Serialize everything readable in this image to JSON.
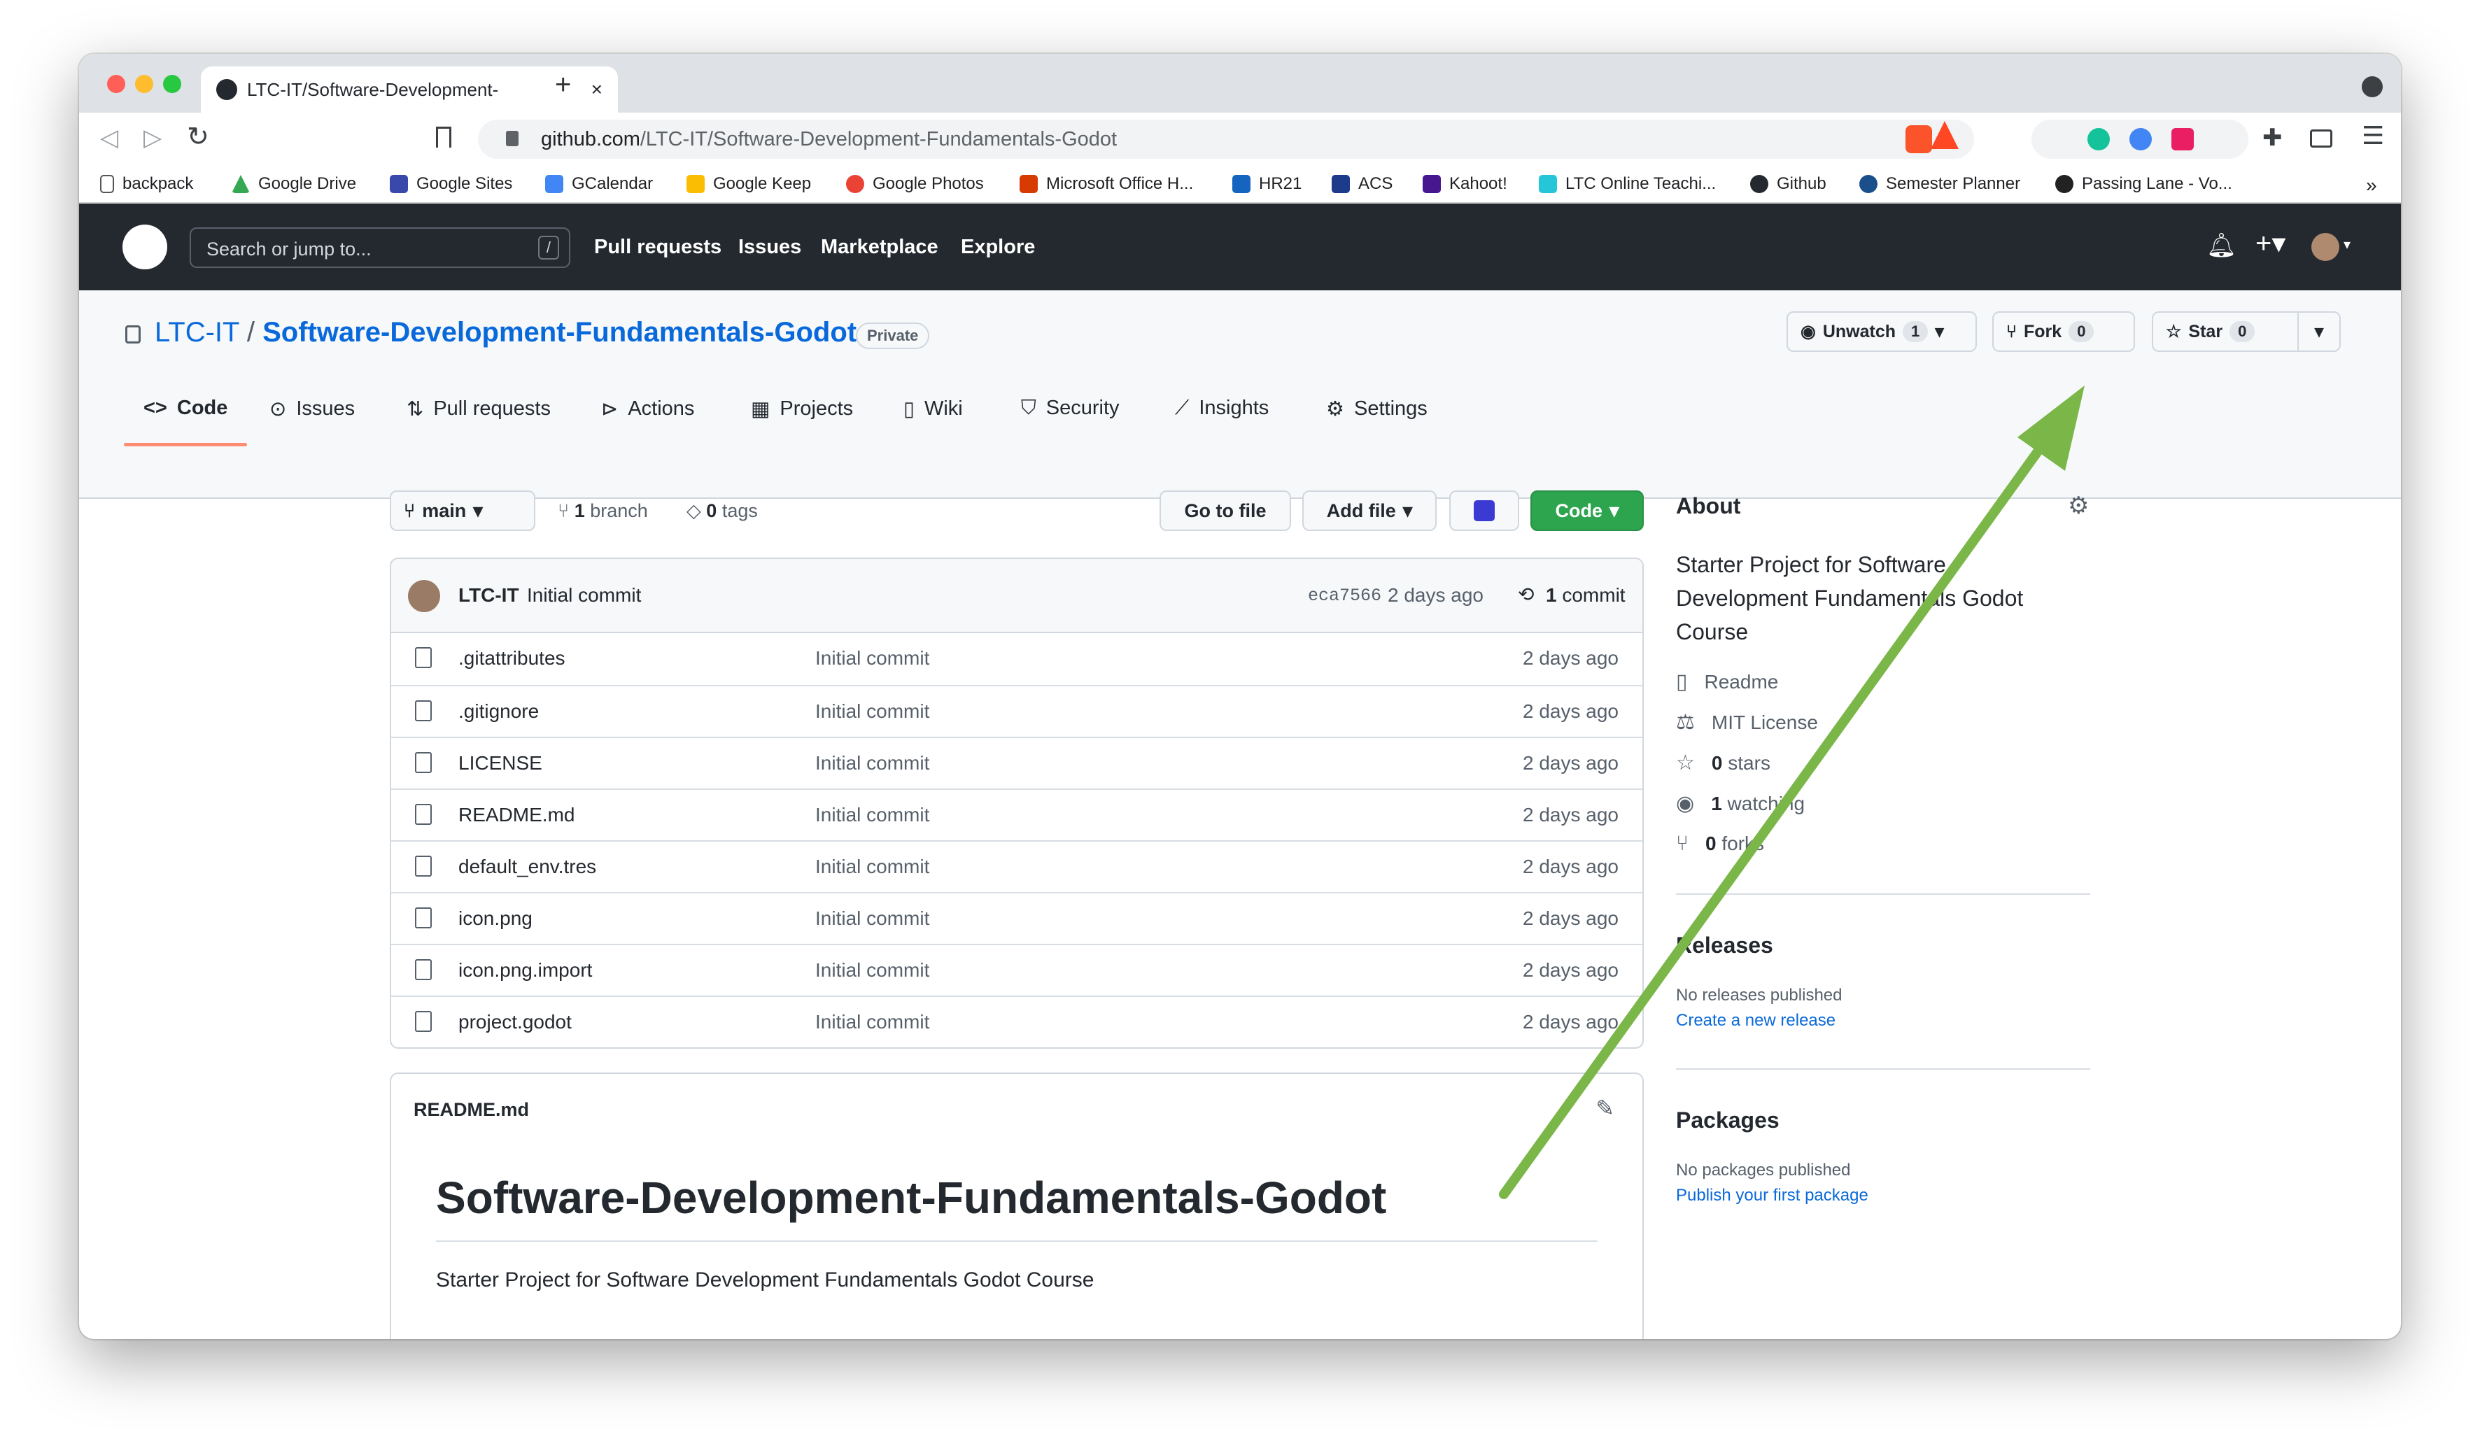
{
  "browser": {
    "tab_title": "LTC-IT/Software-Development-",
    "url_host": "github.com",
    "url_path": "/LTC-IT/Software-Development-Fundamentals-Godot",
    "bookmarks": [
      {
        "label": "backpack",
        "icon": "page-icon",
        "color": "#ffffff"
      },
      {
        "label": "Google Drive",
        "icon": "google-drive-icon",
        "color": "#34a853"
      },
      {
        "label": "Google Sites",
        "icon": "google-sites-icon",
        "color": "#3949ab"
      },
      {
        "label": "GCalendar",
        "icon": "calendar-icon",
        "color": "#4285f4"
      },
      {
        "label": "Google Keep",
        "icon": "keep-icon",
        "color": "#fbbc04"
      },
      {
        "label": "Google Photos",
        "icon": "photos-icon",
        "color": "#ea4335"
      },
      {
        "label": "Microsoft Office H...",
        "icon": "office-icon",
        "color": "#d83b01"
      },
      {
        "label": "HR21",
        "icon": "hr21-icon",
        "color": "#1565c0"
      },
      {
        "label": "ACS",
        "icon": "acs-icon",
        "color": "#1e3a8a"
      },
      {
        "label": "Kahoot!",
        "icon": "kahoot-icon",
        "color": "#46178f"
      },
      {
        "label": "LTC Online Teachi...",
        "icon": "ltc-icon",
        "color": "#26c6da"
      },
      {
        "label": "Github",
        "icon": "github-icon",
        "color": "#24292f"
      },
      {
        "label": "Semester Planner",
        "icon": "planner-icon",
        "color": "#1a4f8b"
      },
      {
        "label": "Passing Lane - Vo...",
        "icon": "passing-lane-icon",
        "color": "#222222"
      }
    ],
    "more_bookmarks": "»"
  },
  "header": {
    "search_placeholder": "Search or jump to...",
    "search_shortcut": "/",
    "nav": [
      "Pull requests",
      "Issues",
      "Marketplace",
      "Explore"
    ]
  },
  "repo": {
    "owner": "LTC-IT",
    "separator": "/",
    "name": "Software-Development-Fundamentals-Godot",
    "visibility": "Private",
    "unwatch_label": "Unwatch",
    "watch_count": "1",
    "fork_label": "Fork",
    "fork_count": "0",
    "star_label": "Star",
    "star_count": "0",
    "tabs": [
      "Code",
      "Issues",
      "Pull requests",
      "Actions",
      "Projects",
      "Wiki",
      "Security",
      "Insights",
      "Settings"
    ]
  },
  "filenav": {
    "branch": "main",
    "branches_count": "1",
    "branches_label": "branch",
    "tags_count": "0",
    "tags_label": "tags",
    "go_to_file": "Go to file",
    "add_file": "Add file",
    "code_label": "Code"
  },
  "commit": {
    "author": "LTC-IT",
    "message": "Initial commit",
    "sha": "eca7566",
    "time": "2 days ago",
    "count": "1",
    "count_label": "commit"
  },
  "files": [
    {
      "name": ".gitattributes",
      "message": "Initial commit",
      "date": "2 days ago"
    },
    {
      "name": ".gitignore",
      "message": "Initial commit",
      "date": "2 days ago"
    },
    {
      "name": "LICENSE",
      "message": "Initial commit",
      "date": "2 days ago"
    },
    {
      "name": "README.md",
      "message": "Initial commit",
      "date": "2 days ago"
    },
    {
      "name": "default_env.tres",
      "message": "Initial commit",
      "date": "2 days ago"
    },
    {
      "name": "icon.png",
      "message": "Initial commit",
      "date": "2 days ago"
    },
    {
      "name": "icon.png.import",
      "message": "Initial commit",
      "date": "2 days ago"
    },
    {
      "name": "project.godot",
      "message": "Initial commit",
      "date": "2 days ago"
    }
  ],
  "readme": {
    "filename": "README.md",
    "heading": "Software-Development-Fundamentals-Godot",
    "body": "Starter Project for Software Development Fundamentals Godot Course"
  },
  "about": {
    "title": "About",
    "description": "Starter Project for Software Development Fundamentals Godot Course",
    "readme": "Readme",
    "license": "MIT License",
    "stars_count": "0",
    "stars_label": "stars",
    "watching_count": "1",
    "watching_label": "watching",
    "forks_count": "0",
    "forks_label": "forks",
    "releases_title": "Releases",
    "releases_none": "No releases published",
    "releases_link": "Create a new release",
    "packages_title": "Packages",
    "packages_none": "No packages published",
    "packages_link": "Publish your first package"
  },
  "annotation": {
    "arrow_color": "#7ab648"
  }
}
